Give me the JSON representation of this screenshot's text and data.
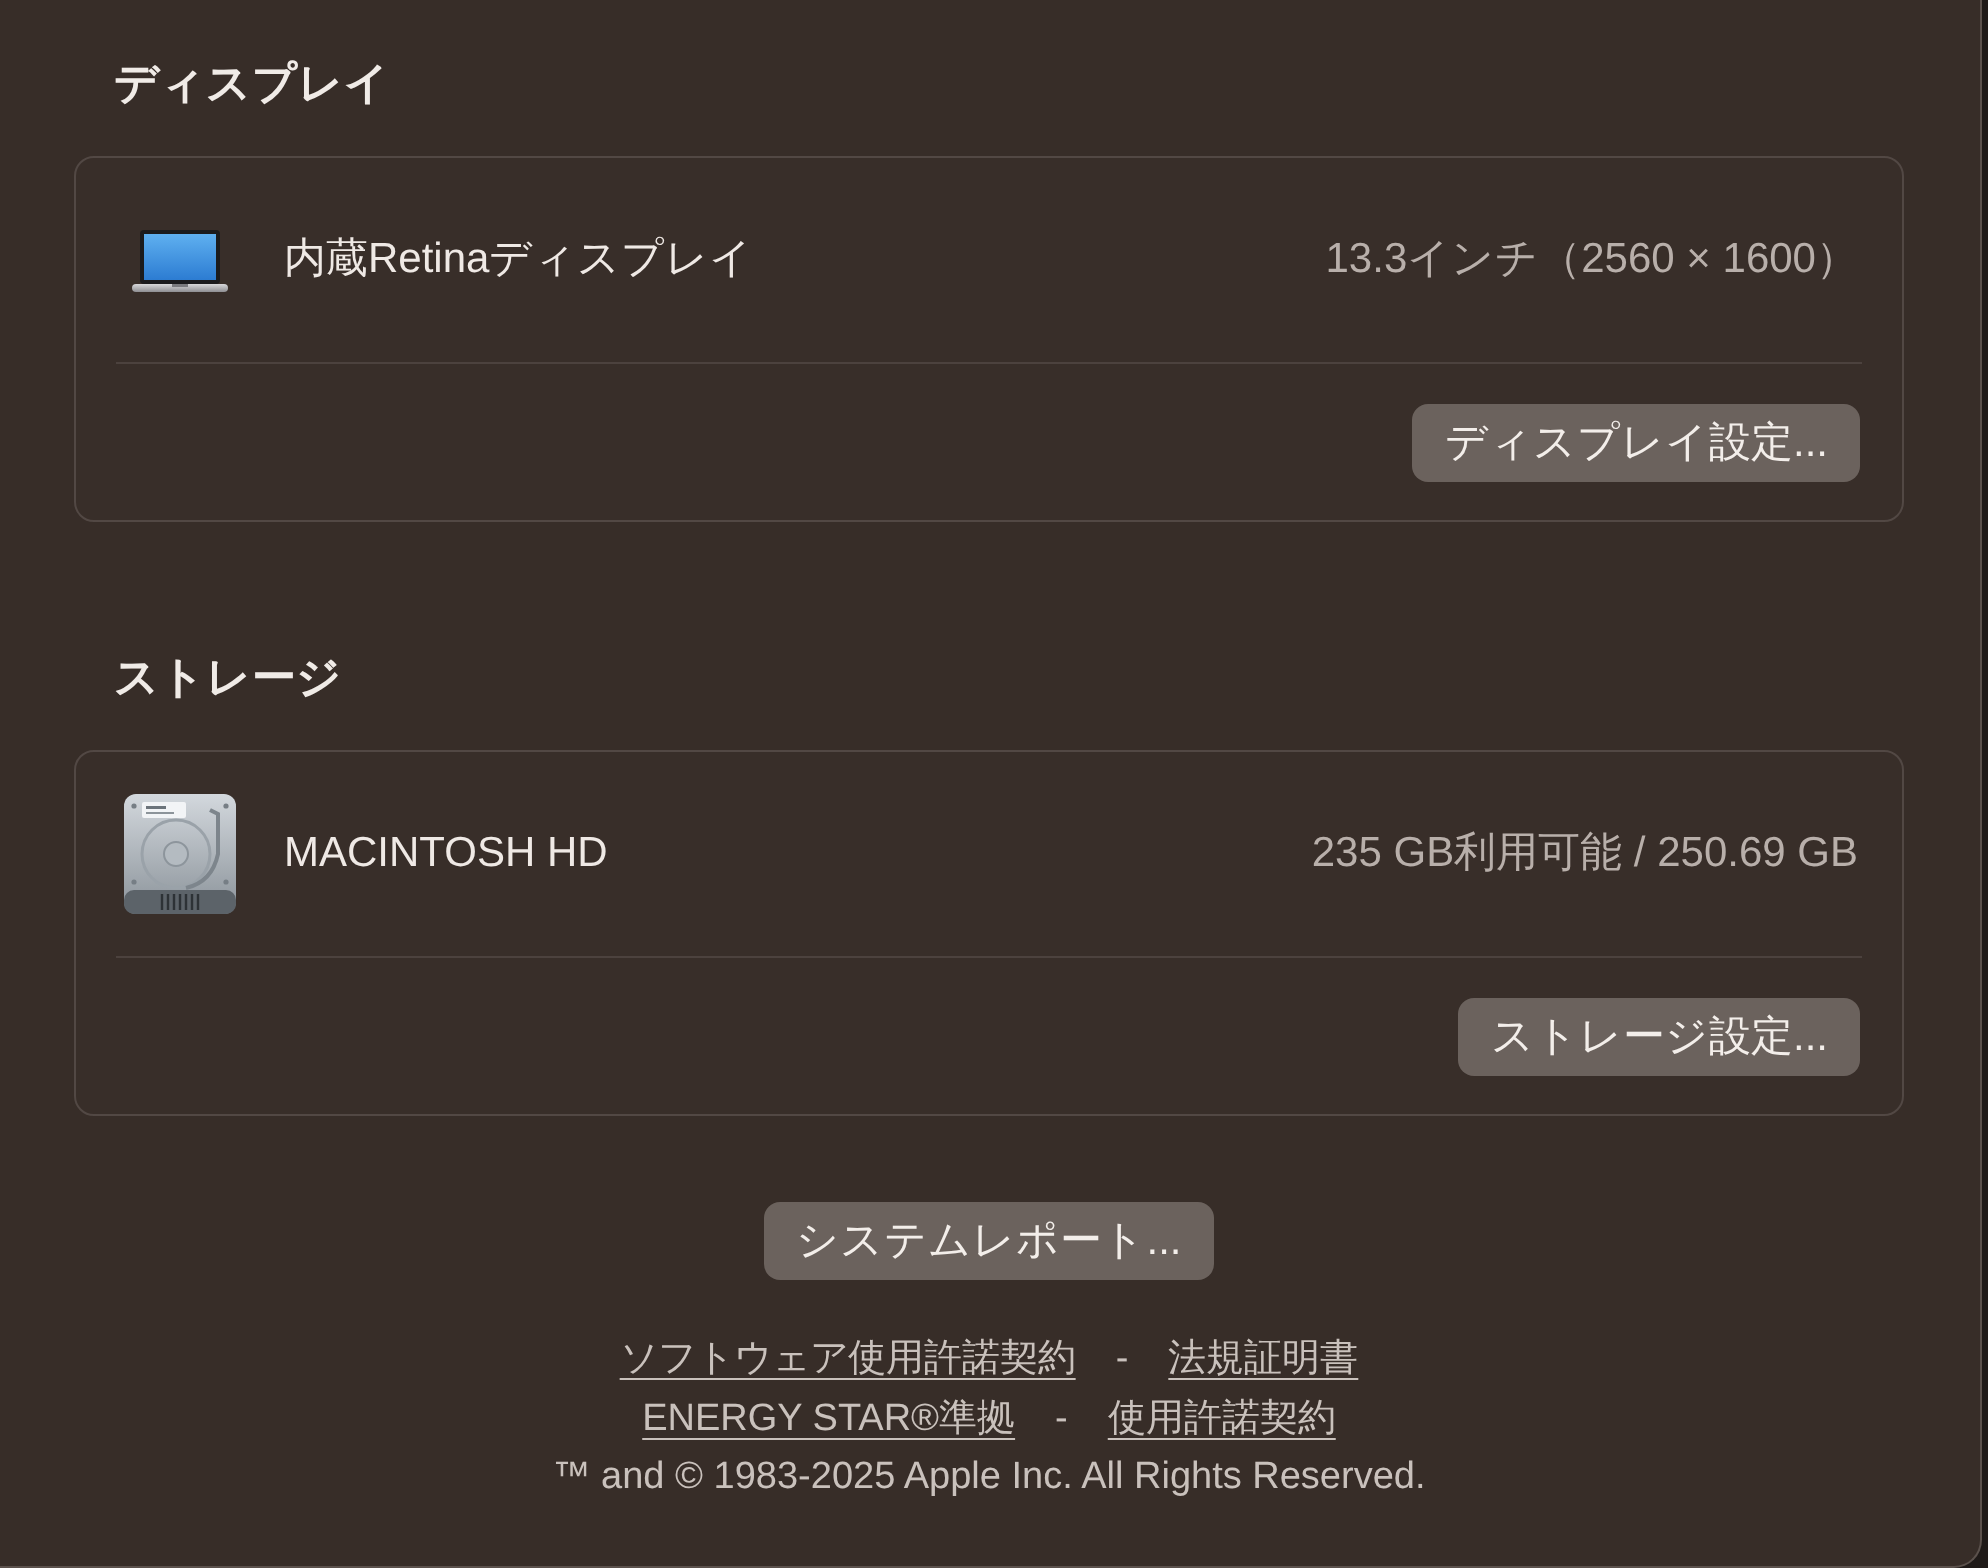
{
  "sections": [
    {
      "heading": "ディスプレイ",
      "items": [
        {
          "kind": "display",
          "name": "内蔵Retinaディスプレイ",
          "detail": "13.3インチ（2560 × 1600）"
        }
      ],
      "button": "ディスプレイ設定..."
    },
    {
      "heading": "ストレージ",
      "items": [
        {
          "kind": "disk",
          "name": "MACINTOSH HD",
          "detail": "235 GB利用可能 / 250.69 GB"
        }
      ],
      "button": "ストレージ設定..."
    }
  ],
  "report_button": "システムレポート...",
  "legal_lines": [
    {
      "links": [
        "ソフトウェア使用許諾契約",
        "法規証明書"
      ],
      "separator": "-"
    },
    {
      "links": [
        "ENERGY STAR®準拠",
        "使用許諾契約"
      ],
      "separator": "-"
    }
  ],
  "copyright": "™ and © 1983-2025 Apple Inc. All Rights Reserved."
}
